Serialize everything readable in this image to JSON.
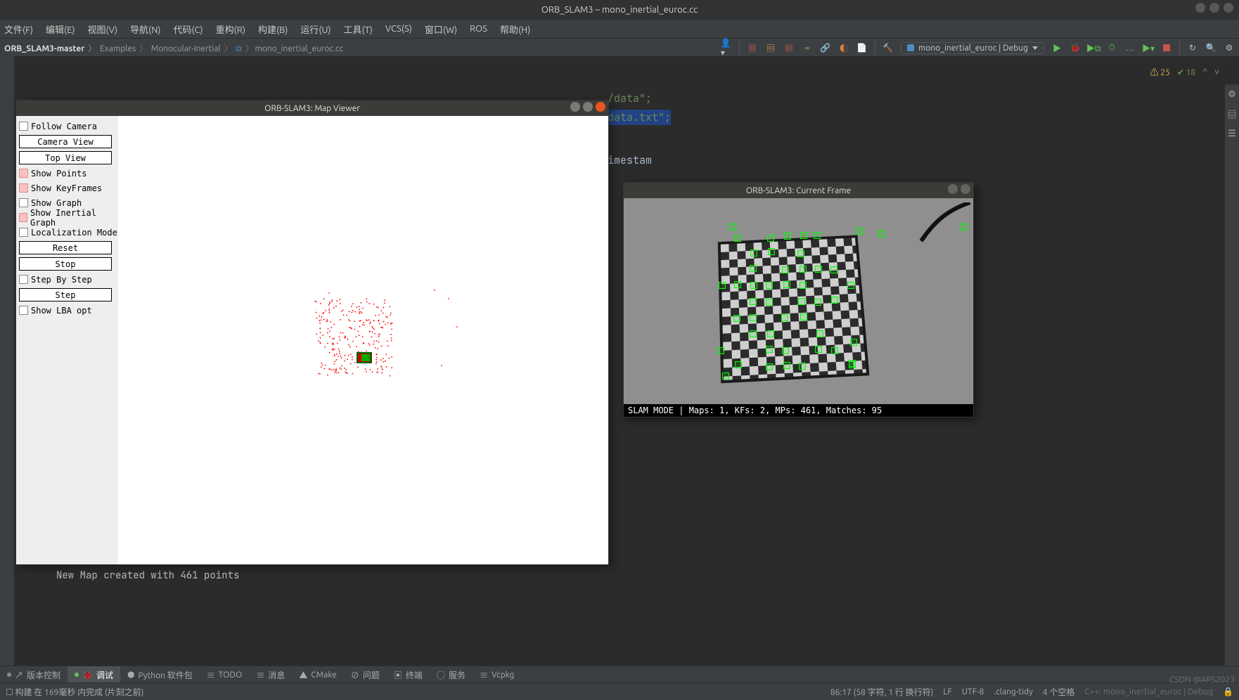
{
  "ide": {
    "title": "ORB_SLAM3 – mono_inertial_euroc.cc",
    "menu": {
      "file": "文件(F)",
      "edit": "编辑(E)",
      "view": "视图(V)",
      "nav": "导航(N)",
      "code": "代码(C)",
      "refactor": "重构(R)",
      "build": "构建(B)",
      "run": "运行(U)",
      "tools": "工具(T)",
      "vcs": "VCS(S)",
      "window": "窗口(W)",
      "ros": "ROS",
      "help": "帮助(H)"
    },
    "breadcrumbs": [
      "ORB_SLAM3-master",
      "Examples",
      "Monocular-Inertial",
      "mono_inertial_euroc.cc"
    ],
    "run_config": "mono_inertial_euroc | Debug",
    "top_warn": {
      "warn": "25",
      "ok": "18"
    },
    "code_line1": "/data\";",
    "code_line2": "data.txt\";",
    "code_later": "imestam",
    "console_line": "New Map created with 461 points",
    "bottom_tabs": {
      "vc": "版本控制",
      "debug": "调试",
      "python": "Python 软件包",
      "todo": "TODO",
      "msg": "消息",
      "cmake": "CMake",
      "problems": "问题",
      "terminal": "终端",
      "services": "服务",
      "vcpkg": "Vcpkg"
    },
    "status_left": "构建 在 169毫秒 内完成 (片刻之前)",
    "status_right": {
      "pos": "86:17 (58 字符, 1 行 换行符)",
      "lf": "LF",
      "enc": "UTF-8",
      "lang": ".clang-tidy",
      "spaces": "4 个空格",
      "tail": "C++: mono_inertial_euroc | Debug"
    },
    "watermark": "CSDN @APS2023"
  },
  "map_viewer": {
    "title": "ORB-SLAM3: Map Viewer",
    "follow_camera": "Follow Camera",
    "camera_view": "Camera View",
    "top_view": "Top View",
    "show_points": "Show Points",
    "show_keyframes": "Show KeyFrames",
    "show_graph": "Show Graph",
    "show_inertial_graph": "Show Inertial Graph",
    "localization_mode": "Localization Mode",
    "reset": "Reset",
    "stop": "Stop",
    "step_by_step": "Step By Step",
    "step": "Step",
    "show_lba_opt": "Show LBA opt"
  },
  "current_frame": {
    "title": "ORB-SLAM3: Current Frame",
    "status": "SLAM MODE  |   Maps: 1, KFs: 2, MPs: 461, Matches: 95"
  }
}
